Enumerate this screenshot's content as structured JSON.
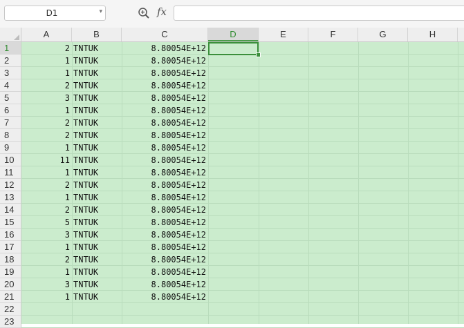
{
  "name_box": {
    "value": "D1"
  },
  "formula_bar": {
    "fx_label": "fx",
    "content": ""
  },
  "columns": [
    "A",
    "B",
    "C",
    "D",
    "E",
    "F",
    "G",
    "H"
  ],
  "active_cell": "D1",
  "rows": [
    {
      "num": "1",
      "a": "2",
      "b": "TNTUK",
      "c": "8.80054E+12"
    },
    {
      "num": "2",
      "a": "1",
      "b": "TNTUK",
      "c": "8.80054E+12"
    },
    {
      "num": "3",
      "a": "1",
      "b": "TNTUK",
      "c": "8.80054E+12"
    },
    {
      "num": "4",
      "a": "2",
      "b": "TNTUK",
      "c": "8.80054E+12"
    },
    {
      "num": "5",
      "a": "3",
      "b": "TNTUK",
      "c": "8.80054E+12"
    },
    {
      "num": "6",
      "a": "1",
      "b": "TNTUK",
      "c": "8.80054E+12"
    },
    {
      "num": "7",
      "a": "2",
      "b": "TNTUK",
      "c": "8.80054E+12"
    },
    {
      "num": "8",
      "a": "2",
      "b": "TNTUK",
      "c": "8.80054E+12"
    },
    {
      "num": "9",
      "a": "1",
      "b": "TNTUK",
      "c": "8.80054E+12"
    },
    {
      "num": "10",
      "a": "11",
      "b": "TNTUK",
      "c": "8.80054E+12"
    },
    {
      "num": "11",
      "a": "1",
      "b": "TNTUK",
      "c": "8.80054E+12"
    },
    {
      "num": "12",
      "a": "2",
      "b": "TNTUK",
      "c": "8.80054E+12"
    },
    {
      "num": "13",
      "a": "1",
      "b": "TNTUK",
      "c": "8.80054E+12"
    },
    {
      "num": "14",
      "a": "2",
      "b": "TNTUK",
      "c": "8.80054E+12"
    },
    {
      "num": "15",
      "a": "5",
      "b": "TNTUK",
      "c": "8.80054E+12"
    },
    {
      "num": "16",
      "a": "3",
      "b": "TNTUK",
      "c": "8.80054E+12"
    },
    {
      "num": "17",
      "a": "1",
      "b": "TNTUK",
      "c": "8.80054E+12"
    },
    {
      "num": "18",
      "a": "2",
      "b": "TNTUK",
      "c": "8.80054E+12"
    },
    {
      "num": "19",
      "a": "1",
      "b": "TNTUK",
      "c": "8.80054E+12"
    },
    {
      "num": "20",
      "a": "3",
      "b": "TNTUK",
      "c": "8.80054E+12"
    },
    {
      "num": "21",
      "a": "1",
      "b": "TNTUK",
      "c": "8.80054E+12"
    },
    {
      "num": "22",
      "a": "",
      "b": "",
      "c": ""
    },
    {
      "num": "23",
      "a": "",
      "b": "",
      "c": ""
    }
  ],
  "colors": {
    "grid_background": "#cbeccd",
    "active_accent": "#3b8f3b",
    "header_background": "#eeeeee"
  },
  "icons": {
    "zoom": "magnifier-zoom-icon",
    "dropdown": "chevron-down-icon"
  }
}
